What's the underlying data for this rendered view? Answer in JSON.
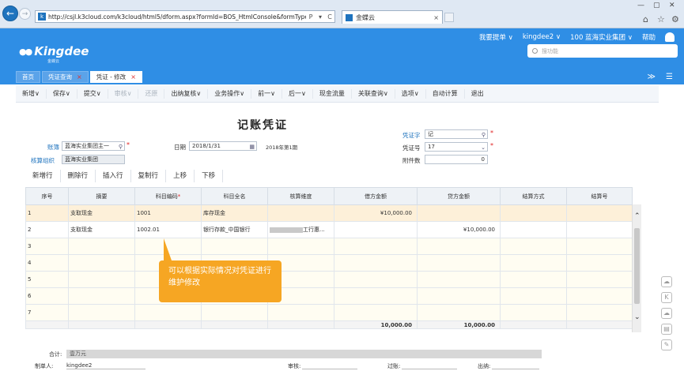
{
  "browser": {
    "url": "http://csjl.k3cloud.com/k3cloud/html5/dform.aspx?formId=BOS_HtmlConsole&formType=",
    "url_controls": [
      "P",
      "▾",
      "C"
    ],
    "tab_title": "金蝶云",
    "tab_close": "×",
    "window_controls": [
      "—",
      "▢",
      "✕"
    ],
    "right_tools": [
      "⌂",
      "☆",
      "⚙"
    ]
  },
  "app": {
    "logo_text": "Kingdee",
    "logo_sub": "金蝶云",
    "topnav": [
      "我要提单 ∨",
      "kingdee2 ∨",
      "100 蓝海实业集团 ∨",
      "帮助"
    ],
    "search_placeholder": "搜功能",
    "tabs": [
      {
        "label": "首页",
        "close": ""
      },
      {
        "label": "凭证查询",
        "close": "×"
      },
      {
        "label": "凭证 - 修改",
        "close": "×"
      }
    ],
    "collapse_icon": "≫",
    "menu_icon": "☰"
  },
  "toolbar": [
    {
      "label": "新增∨",
      "disabled": false
    },
    {
      "label": "保存∨",
      "disabled": false
    },
    {
      "label": "提交∨",
      "disabled": false
    },
    {
      "label": "审核∨",
      "disabled": true
    },
    {
      "label": "还原",
      "disabled": true
    },
    {
      "label": "出纳复核∨",
      "disabled": false
    },
    {
      "label": "业务操作∨",
      "disabled": false
    },
    {
      "label": "前一∨",
      "disabled": false
    },
    {
      "label": "后一∨",
      "disabled": false
    },
    {
      "label": "现金流量",
      "disabled": false
    },
    {
      "label": "关联查询∨",
      "disabled": false
    },
    {
      "label": "选项∨",
      "disabled": false
    },
    {
      "label": "自动计算",
      "disabled": false
    },
    {
      "label": "退出",
      "disabled": false
    }
  ],
  "form": {
    "title": "记账凭证",
    "account_book_label": "账簿",
    "account_book_value": "蓝海实业集团主一",
    "account_org_label": "核算组织",
    "account_org_value": "蓝海实业集团",
    "date_label": "日期",
    "date_value": "2018/1/31",
    "period": "2018年第1期",
    "voucher_word_label": "凭证字",
    "voucher_word_value": "记",
    "voucher_no_label": "凭证号",
    "voucher_no_value": "17",
    "attachments_label": "附件数",
    "attachments_value": "0"
  },
  "grid_actions": [
    "新增行",
    "删除行",
    "插入行",
    "复制行",
    "上移",
    "下移"
  ],
  "table": {
    "headers": [
      "序号",
      "摘要",
      "科目编码",
      "科目全名",
      "核算维度",
      "借方金额",
      "贷方金额",
      "结算方式",
      "结算号"
    ],
    "required_mark": "*",
    "rows": [
      {
        "no": "1",
        "summary": "支取现金",
        "code": "1001",
        "name": "库存现金",
        "dim": "",
        "debit": "¥10,000.00",
        "credit": ""
      },
      {
        "no": "2",
        "summary": "支取现金",
        "code": "1002.01",
        "name": "银行存款_中国银行",
        "dim": "工行惠...",
        "debit": "",
        "credit": "¥10,000.00"
      },
      {
        "no": "3",
        "summary": "",
        "code": "",
        "name": "",
        "dim": "",
        "debit": "",
        "credit": ""
      },
      {
        "no": "4",
        "summary": "",
        "code": "",
        "name": "",
        "dim": "",
        "debit": "",
        "credit": ""
      },
      {
        "no": "5",
        "summary": "",
        "code": "",
        "name": "",
        "dim": "",
        "debit": "",
        "credit": ""
      },
      {
        "no": "6",
        "summary": "",
        "code": "",
        "name": "",
        "dim": "",
        "debit": "",
        "credit": ""
      },
      {
        "no": "7",
        "summary": "",
        "code": "",
        "name": "",
        "dim": "",
        "debit": "",
        "credit": ""
      }
    ],
    "total_debit": "10,000.00",
    "total_credit": "10,000.00"
  },
  "tooltip": "可以根据实际情况对凭证进行维护修改",
  "footer": {
    "total_label": "合计:",
    "total_value": "壹万元",
    "maker_label": "制单人:",
    "maker_value": "kingdee2",
    "auditor_label": "审核:",
    "poster_label": "过账:",
    "cashier_label": "出纳:"
  }
}
